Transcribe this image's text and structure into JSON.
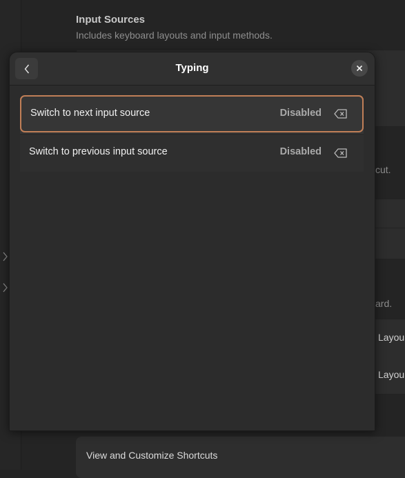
{
  "background": {
    "section_title": "Input Sources",
    "section_subtitle": "Includes keyboard layouts and input methods.",
    "fragment_cut": "cut.",
    "fragment_ard": "ard.",
    "layout_label_1": "Layou",
    "layout_label_2": "Layou",
    "bottom_link": "View and Customize Shortcuts"
  },
  "dialog": {
    "title": "Typing",
    "back_icon": "chevron-left-icon",
    "close_icon": "close-icon"
  },
  "shortcuts": [
    {
      "label": "Switch to next input source",
      "value": "Disabled",
      "clear_icon": "backspace-icon",
      "focused": true
    },
    {
      "label": "Switch to previous input source",
      "value": "Disabled",
      "clear_icon": "backspace-icon",
      "focused": false
    }
  ],
  "colors": {
    "focus_ring": "#c17f57",
    "dialog_bg": "#2c2c2c",
    "row_bg": "#363636"
  }
}
